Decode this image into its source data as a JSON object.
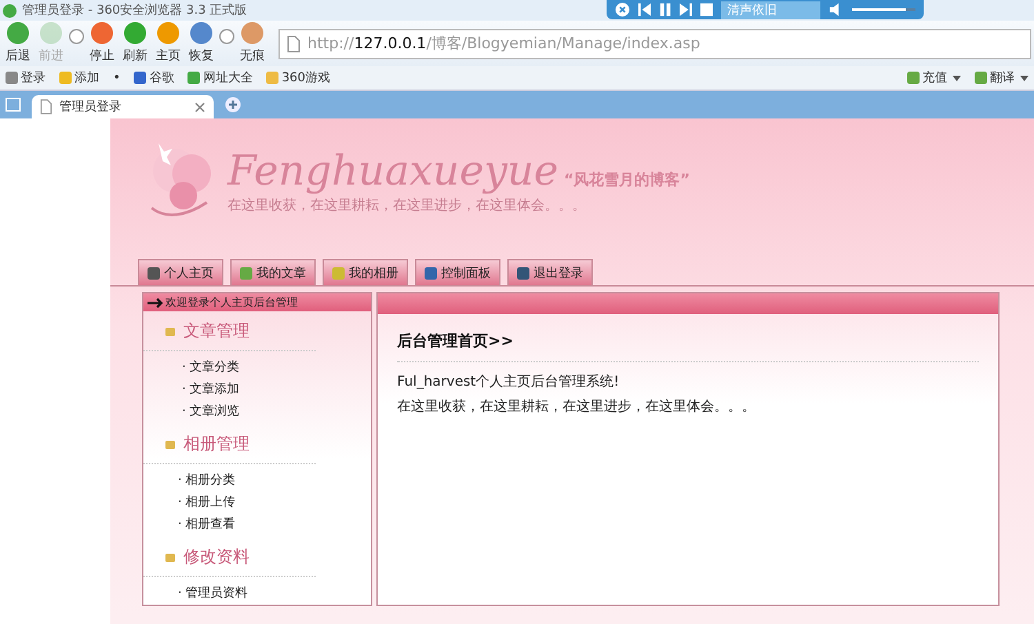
{
  "window": {
    "title": "管理员登录 - 360安全浏览器 3.3 正式版"
  },
  "media_player": {
    "track": "清声依旧",
    "volume": {
      "level": 0.85
    }
  },
  "toolbar": [
    {
      "kind": "back",
      "label": "后退",
      "disabled": false
    },
    {
      "kind": "forward",
      "label": "前进",
      "disabled": true
    },
    {
      "kind": "stop",
      "label": "停止",
      "disabled": false
    },
    {
      "kind": "refresh",
      "label": "刷新",
      "disabled": false
    },
    {
      "kind": "home",
      "label": "主页",
      "disabled": false
    },
    {
      "kind": "restore",
      "label": "恢复",
      "disabled": false
    },
    {
      "kind": "private",
      "label": "无痕",
      "disabled": false
    }
  ],
  "address_bar": {
    "url": "http://**127.0.0.1**/博客/Blogyemian/Manage/index.asp"
  },
  "bookmarks": [
    {
      "kind": "user",
      "label": "登录"
    },
    {
      "kind": "star",
      "label": "添加"
    },
    {
      "kind": "dot",
      "label": "•"
    },
    {
      "kind": "google",
      "label": "谷歌"
    },
    {
      "kind": "globe",
      "label": "网址大全"
    },
    {
      "kind": "folder",
      "label": "360游戏"
    }
  ],
  "bookmarks_right": [
    {
      "label": "充值"
    },
    {
      "label": "翻译"
    }
  ],
  "tabs": [
    {
      "label": "管理员登录",
      "selected": true
    }
  ],
  "site": {
    "logo": "Fenghuaxueyue",
    "tagline": "“风花雪月的博客”",
    "slogan": "在这里收获，在这里耕耘，在这里进步，在这里体会。。。",
    "nav": [
      {
        "kind": "home",
        "label": "个人主页"
      },
      {
        "kind": "article",
        "label": "我的文章"
      },
      {
        "kind": "photo",
        "label": "我的相册"
      },
      {
        "kind": "panel",
        "label": "控制面板"
      },
      {
        "kind": "logout",
        "label": "退出登录"
      }
    ],
    "sidebar": {
      "header": "欢迎登录个人主页后台管理",
      "sections": [
        {
          "title": "文章管理",
          "items": [
            "· 文章分类",
            "· 文章添加",
            "· 文章浏览"
          ]
        },
        {
          "title": "相册管理",
          "items": [
            "· 相册分类",
            "· 相册上传",
            "· 相册查看"
          ]
        },
        {
          "title": "修改资料",
          "items": [
            "· 管理员资料"
          ]
        }
      ]
    },
    "content": {
      "title": "后台管理首页>>",
      "lines": [
        "Ful_harvest个人主页后台管理系统!",
        "在这里收获，在这里耕耘，在这里进步，在这里体会。。。"
      ]
    }
  }
}
